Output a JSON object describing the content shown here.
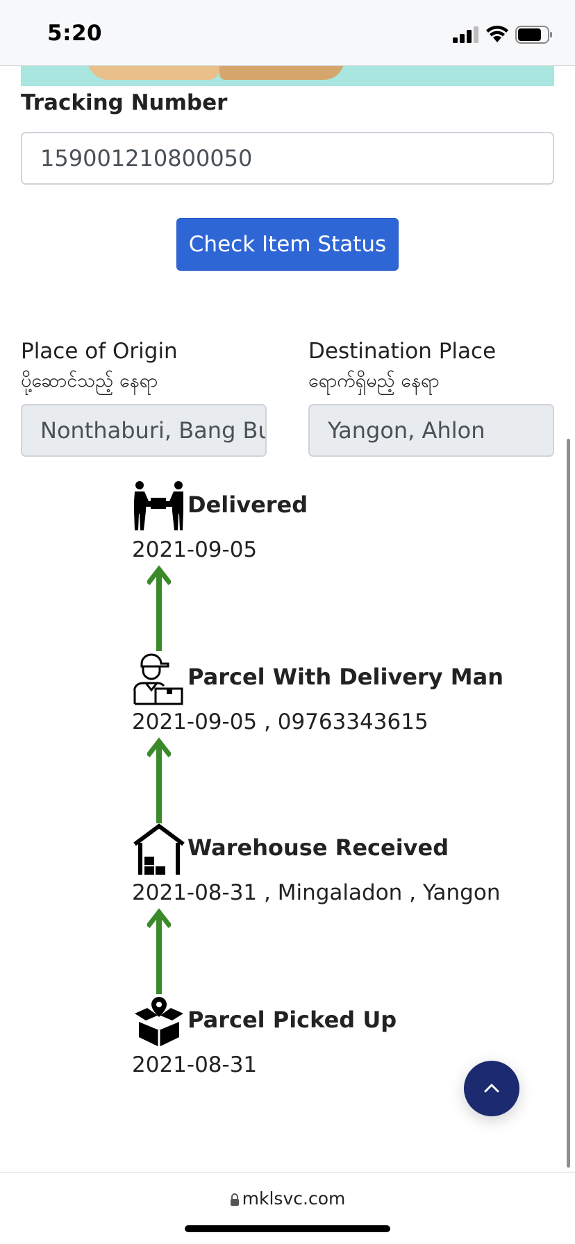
{
  "status_bar": {
    "time": "5:20"
  },
  "form": {
    "tracking_label": "Tracking Number",
    "tracking_value": "159001210800050",
    "check_button": "Check Item Status"
  },
  "origin": {
    "label": "Place of Origin",
    "label_mm": "ပို့ဆောင်သည့် နေရာ",
    "value": "Nonthaburi, Bang Bu"
  },
  "destination": {
    "label": "Destination Place",
    "label_mm": "ရောက်ရှိမည့် နေရာ",
    "value": "Yangon, Ahlon"
  },
  "timeline": [
    {
      "icon": "handover-icon",
      "title": "Delivered",
      "detail": "2021-09-05"
    },
    {
      "icon": "delivery-man-icon",
      "title": "Parcel With Delivery Man",
      "detail": "2021-09-05 , 09763343615"
    },
    {
      "icon": "warehouse-icon",
      "title": "Warehouse Received",
      "detail": "2021-08-31 , Mingaladon , Yangon"
    },
    {
      "icon": "parcel-pin-icon",
      "title": "Parcel Picked Up",
      "detail": "2021-08-31"
    }
  ],
  "browser": {
    "url": "mklsvc.com"
  },
  "colors": {
    "primary": "#2f66d6",
    "arrow": "#3a8a2a",
    "scroll_button": "#1c2a70",
    "banner": "#a8e6df"
  }
}
